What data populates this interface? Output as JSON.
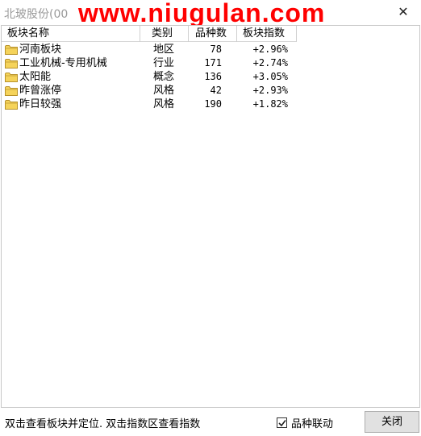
{
  "window": {
    "title": "北玻股份(00",
    "watermark": "www.niugulan.com",
    "close_glyph": "✕"
  },
  "table": {
    "columns": {
      "name": "板块名称",
      "type": "类别",
      "count": "品种数",
      "index": "板块指数"
    },
    "rows": [
      {
        "name": "河南板块",
        "type": "地区",
        "count": "78",
        "index": "+2.96%"
      },
      {
        "name": "工业机械-专用机械",
        "type": "行业",
        "count": "171",
        "index": "+2.74%"
      },
      {
        "name": "太阳能",
        "type": "概念",
        "count": "136",
        "index": "+3.05%"
      },
      {
        "name": "昨曾涨停",
        "type": "风格",
        "count": "42",
        "index": "+2.93%"
      },
      {
        "name": "昨日较强",
        "type": "风格",
        "count": "190",
        "index": "+1.82%"
      }
    ]
  },
  "status": {
    "hint": "双击查看板块并定位. 双击指数区查看指数",
    "link_checkbox_label": "品种联动",
    "link_checkbox_checked": true,
    "close_button_label": "关闭"
  },
  "icons": {
    "row_icon": "folder-icon",
    "folder_color": "#f5d35a"
  }
}
